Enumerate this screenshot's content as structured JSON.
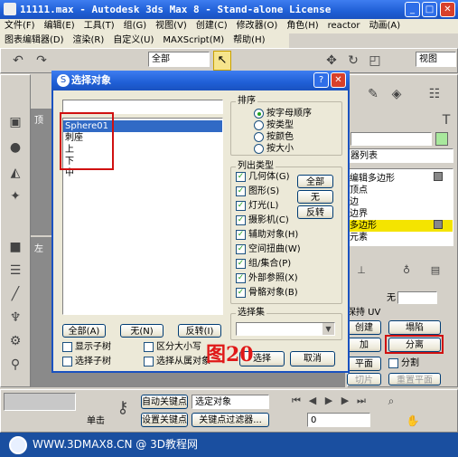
{
  "window": {
    "title": "11111.max - Autodesk 3ds Max 8  - Stand-alone License",
    "min": "_",
    "max": "□",
    "close": "✕"
  },
  "menu": [
    "文件(F)",
    "编辑(E)",
    "工具(T)",
    "组(G)",
    "视图(V)",
    "创建(C)",
    "修改器(O)",
    "角色(H)",
    "reactor",
    "动画(A)"
  ],
  "menu2": [
    "图表编辑器(D)",
    "渲染(R)",
    "自定义(U)",
    "MAXScript(M)",
    "帮助(H)"
  ],
  "toolbar": {
    "selection_filter": "全部",
    "view_dropdown": "视图"
  },
  "viewports": {
    "top": "顶",
    "left": "左"
  },
  "right_panel": {
    "modifier_list": "器列表",
    "stack": [
      "编辑多边形",
      "顶点",
      "边",
      "边界",
      "多边形",
      "元素"
    ],
    "selected_stack_index": 4,
    "preserve_uv": "保持 UV",
    "none_label": "无",
    "create": "创建",
    "collapse": "塌陷",
    "attach": "加",
    "detach": "分离",
    "plane": "平面",
    "split": "分割",
    "slice": "切片",
    "reset_plane": "重置平面"
  },
  "dialog": {
    "title": "选择对象",
    "help": "?",
    "close": "✕",
    "objects": [
      "Sphere01",
      "刺座",
      "上",
      "下",
      "中"
    ],
    "sort_title": "排序",
    "sort": [
      {
        "label": "按字母顺序",
        "on": true
      },
      {
        "label": "按类型",
        "on": false
      },
      {
        "label": "按颜色",
        "on": false
      },
      {
        "label": "按大小",
        "on": false
      }
    ],
    "list_types_title": "列出类型",
    "types": [
      "几何体(G)",
      "图形(S)",
      "灯光(L)",
      "摄影机(C)",
      "辅助对象(H)",
      "空间扭曲(W)",
      "组/集合(P)",
      "外部参照(X)",
      "骨骼对象(B)"
    ],
    "type_buttons": [
      "全部",
      "无",
      "反转"
    ],
    "bottom_buttons": [
      "全部(A)",
      "无(N)",
      "反转(I)"
    ],
    "options": [
      "显示子树",
      "区分大小写",
      "选择子树",
      "选择从属对象"
    ],
    "selection_set_title": "选择集",
    "select": "选择",
    "cancel": "取消"
  },
  "annotation": "图20",
  "bottom": {
    "auto_key": "自动关键点",
    "set_key": "设置关键点",
    "selected": "选定对象",
    "key_filters": "关键点过滤器...",
    "frame": "0",
    "click_hint": "单击"
  },
  "footer": {
    "text": "WWW.3DMAX8.CN @ 3D教程网"
  }
}
